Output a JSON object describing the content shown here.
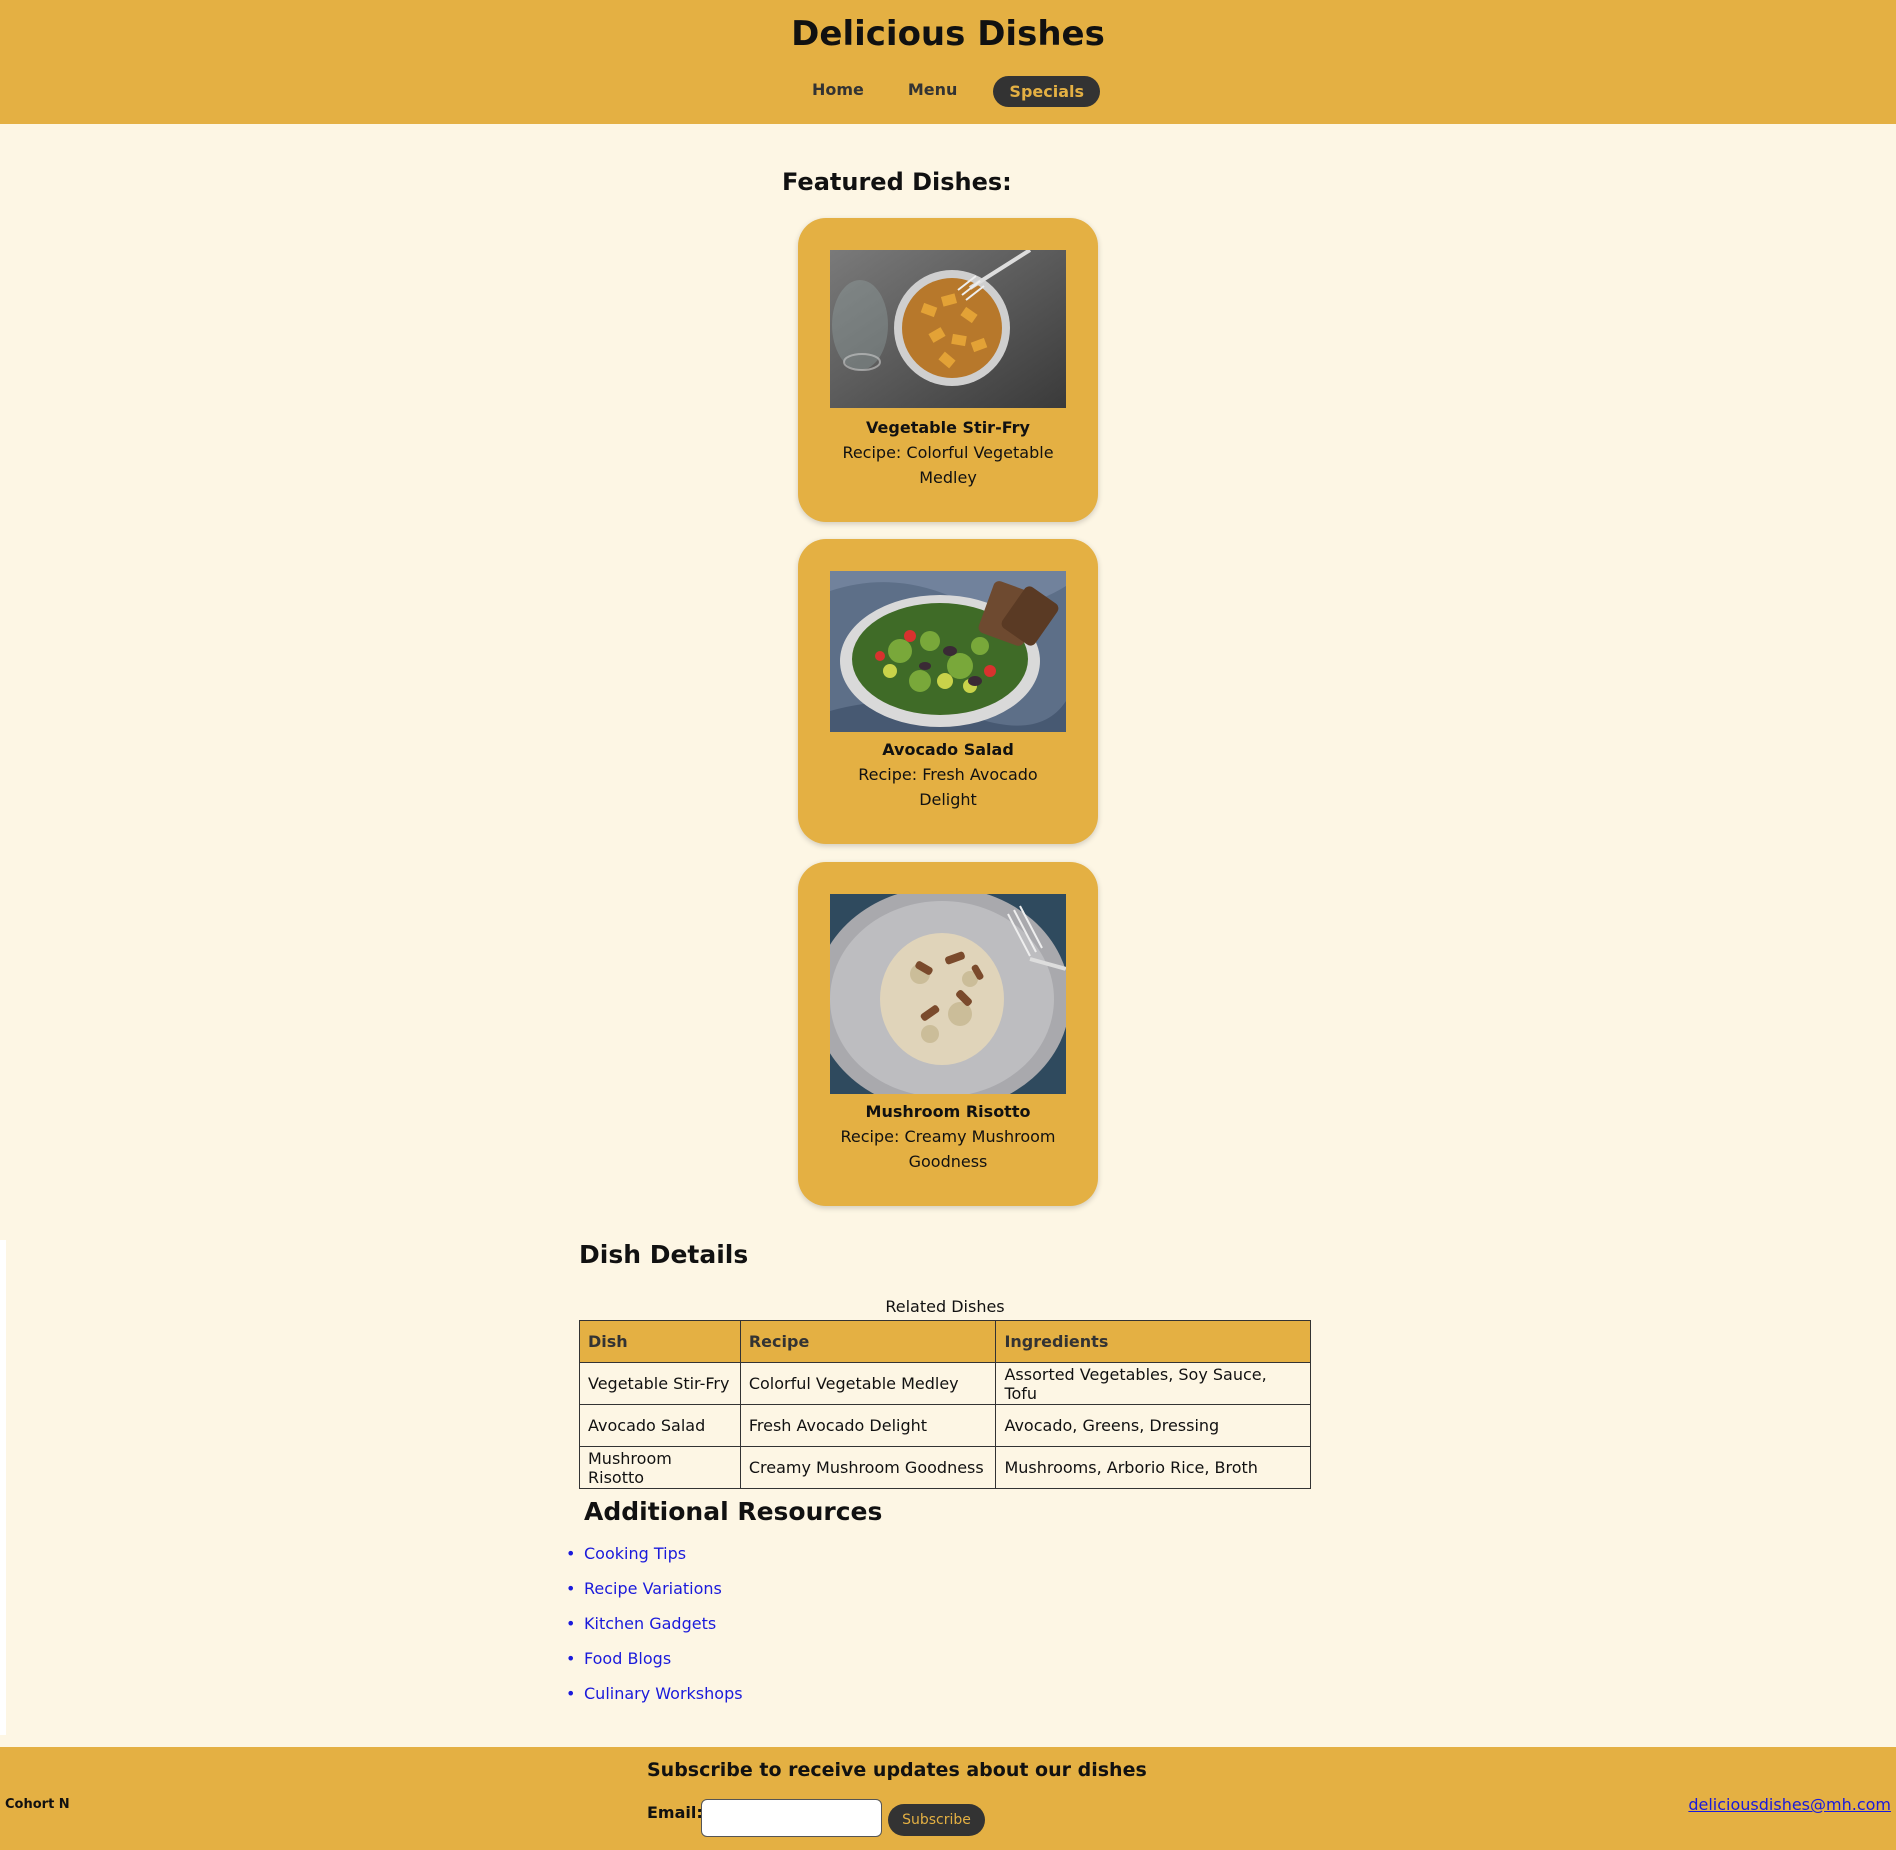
{
  "header": {
    "title": "Delicious Dishes",
    "nav": [
      {
        "label": "Home"
      },
      {
        "label": "Menu"
      },
      {
        "label": "Specials"
      }
    ]
  },
  "featured": {
    "heading": "Featured Dishes:",
    "cards": [
      {
        "name": "Vegetable Stir-Fry",
        "recipe": "Recipe: Colorful Vegetable Medley"
      },
      {
        "name": "Avocado Salad",
        "recipe": "Recipe: Fresh Avocado Delight"
      },
      {
        "name": "Mushroom Risotto",
        "recipe": "Recipe: Creamy Mushroom Goodness"
      }
    ]
  },
  "details": {
    "heading": "Dish Details",
    "caption": "Related Dishes",
    "columns": [
      "Dish",
      "Recipe",
      "Ingredients"
    ],
    "rows": [
      [
        "Vegetable Stir-Fry",
        "Colorful Vegetable Medley",
        "Assorted Vegetables, Soy Sauce, Tofu"
      ],
      [
        "Avocado Salad",
        "Fresh Avocado Delight",
        "Avocado, Greens, Dressing"
      ],
      [
        "Mushroom Risotto",
        "Creamy Mushroom Goodness",
        "Mushrooms, Arborio Rice, Broth"
      ]
    ]
  },
  "resources": {
    "heading": "Additional Resources",
    "links": [
      "Cooking Tips",
      "Recipe Variations",
      "Kitchen Gadgets",
      "Food Blogs",
      "Culinary Workshops"
    ]
  },
  "footer": {
    "cohort": "Cohort N",
    "subscribe_heading": "Subscribe to receive updates about our dishes",
    "email_label": "Email:",
    "subscribe_button": "Subscribe",
    "contact_email": "deliciousdishes@mh.com"
  },
  "colors": {
    "accent": "#e4b043",
    "background": "#fdf6e4",
    "dark": "#333333",
    "link": "#1a1adb"
  }
}
